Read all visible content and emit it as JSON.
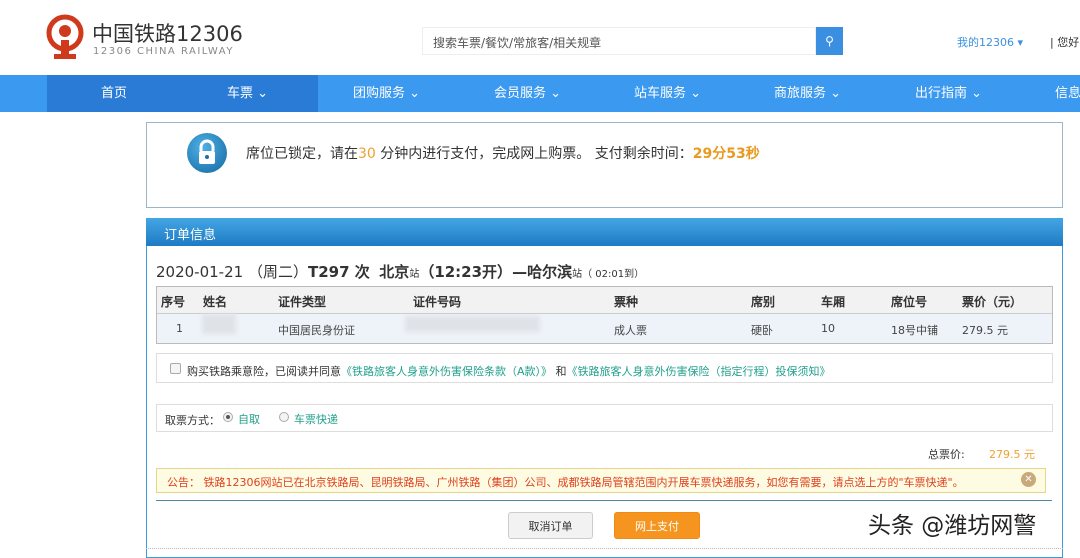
{
  "header": {
    "logo_cn": "中国铁路12306",
    "logo_en": "12306 CHINA RAILWAY",
    "search_placeholder": "搜索车票/餐饮/常旅客/相关规章",
    "my12306": "我的12306 ▾",
    "hello": "| 您好，"
  },
  "nav": [
    "首页",
    "车票 ⌄",
    "团购服务 ⌄",
    "会员服务 ⌄",
    "站车服务 ⌄",
    "商旅服务 ⌄",
    "出行指南 ⌄",
    "信息"
  ],
  "lock": {
    "t1": "席位已锁定，请在",
    "minutes": "30",
    "t2": " 分钟内进行支付，完成网上购票。 支付剩余时间：",
    "remaining": "29分53秒"
  },
  "order": {
    "title": "订单信息",
    "train": {
      "date": "2020-01-21",
      "weekday": "（周二）",
      "train_no": "T297 次",
      "from": "北京",
      "station_suffix": "站",
      "depart": "（12:23开）",
      "to": "—哈尔滨",
      "arrive": "（ 02:01到）"
    },
    "columns": [
      "序号",
      "姓名",
      "证件类型",
      "证件号码",
      "票种",
      "席别",
      "车厢",
      "席位号",
      "票价（元）"
    ],
    "row": {
      "no": "1",
      "id_type": "中国居民身份证",
      "ticket_type": "成人票",
      "seat_class": "硬卧",
      "car": "10",
      "seat": "18号中铺",
      "price": "279.5 元"
    },
    "insurance": {
      "t1": "购买铁路乘意险，已阅读并同意",
      "link1": "《铁路旅客人身意外伤害保险条款（A款）》",
      "and": " 和",
      "link2": "《铁路旅客人身意外伤害保险（指定行程）投保须知》"
    },
    "pickup": {
      "label": "取票方式：",
      "opt1": "自取",
      "opt2": "车票快递"
    },
    "total_label": "总票价:",
    "total_value": "279.5 元",
    "notice": "公告：  铁路12306网站已在北京铁路局、昆明铁路局、广州铁路（集团）公司、成都铁路局管辖范围内开展车票快递服务，如您有需要，请点选上方的\"车票快递\"。",
    "cancel": "取消订单",
    "pay": "网上支付"
  },
  "watermark": "头条 @潍坊网警"
}
